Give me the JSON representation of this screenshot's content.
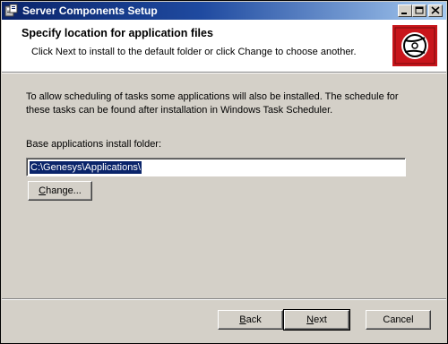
{
  "window": {
    "title": "Server Components Setup"
  },
  "banner": {
    "heading": "Specify location for application files",
    "subheading": "Click Next to install to the default folder or click Change to choose another."
  },
  "main": {
    "description": "To allow scheduling of tasks some applications will also be installed.  The schedule for these tasks can be found after installation in Windows Task Scheduler.",
    "folder_label": "Base applications install folder:",
    "folder_value": "C:\\Genesys\\Applications\\",
    "change_button": {
      "mnemonic": "C",
      "rest": "hange..."
    }
  },
  "footer": {
    "back_button": {
      "mnemonic": "B",
      "rest": "ack"
    },
    "next_button": {
      "mnemonic": "N",
      "rest": "ext"
    },
    "cancel_label": "Cancel"
  },
  "colors": {
    "titlebar_start": "#0a246a",
    "titlebar_end": "#a6caf0",
    "dialog_face": "#d4d0c8",
    "logo_red": "#c8151b",
    "selection": "#0a246a"
  },
  "icons": [
    "installer-app-icon",
    "minimize-icon",
    "maximize-icon",
    "close-icon",
    "setup-logo-icon"
  ]
}
